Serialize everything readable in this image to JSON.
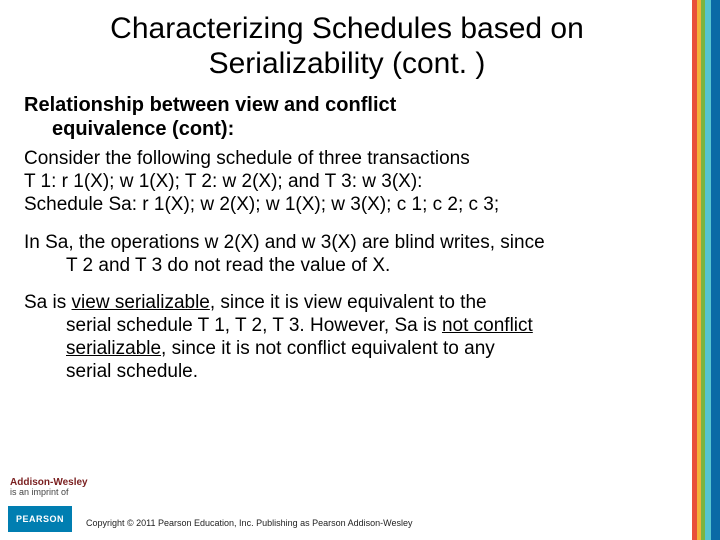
{
  "title": "Characterizing Schedules based on Serializability (cont. )",
  "subhead_line1": "Relationship between view and conflict",
  "subhead_line2": "equivalence (cont):",
  "block1": {
    "l1": "Consider the following schedule of three transactions",
    "l2": "T 1: r 1(X); w 1(X);  T 2: w 2(X);     and    T 3: w 3(X):",
    "l3": "Schedule Sa: r 1(X); w 2(X); w 1(X); w 3(X); c 1; c 2; c 3;"
  },
  "block2": {
    "l1": "In Sa, the operations w 2(X) and w 3(X) are blind writes, since",
    "l2": "T 2 and T 3 do not read the value of X."
  },
  "block3": {
    "l1a": "Sa is ",
    "l1b": "view serializable",
    "l1c": ", since it is view equivalent to the",
    "l2a": "serial schedule T 1, T 2, T 3. However, Sa is ",
    "l2b": "not conflict",
    "l3a": "serializable",
    "l3b": ", since it is not conflict equivalent to any",
    "l4": "serial schedule."
  },
  "publisher": {
    "brand": "Addison-Wesley",
    "tag": "is an imprint of"
  },
  "logo": "PEARSON",
  "copyright": "Copyright © 2011 Pearson Education, Inc. Publishing as Pearson Addison-Wesley"
}
